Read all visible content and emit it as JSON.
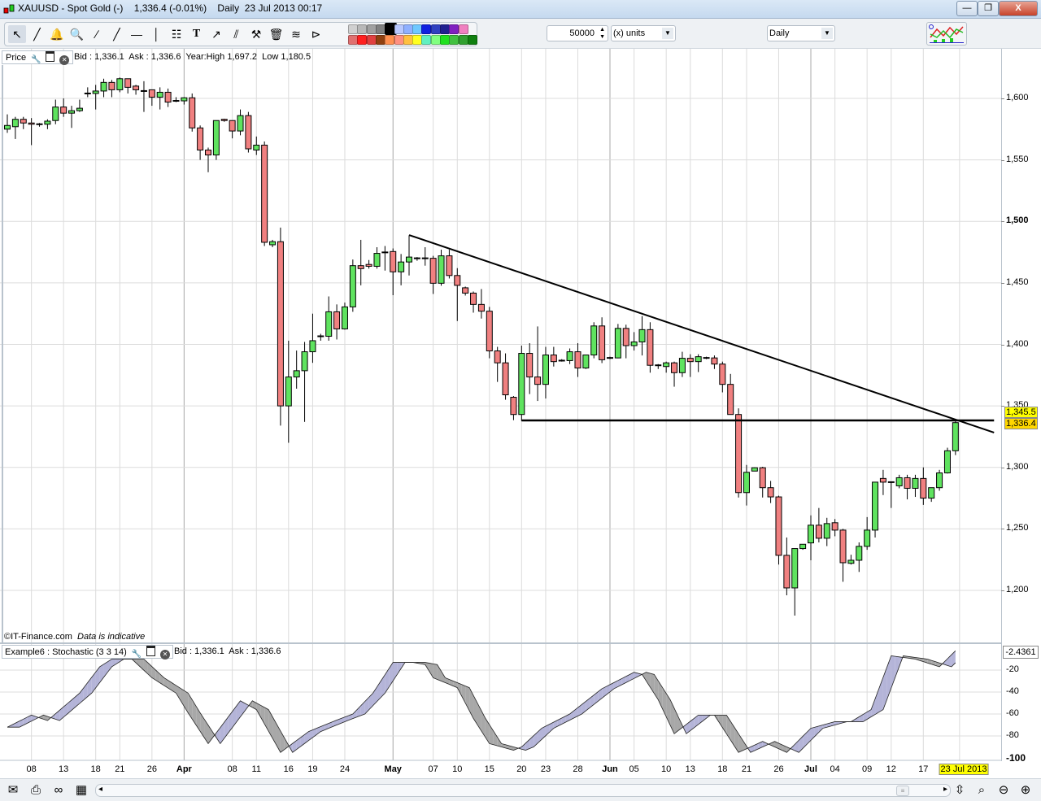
{
  "window": {
    "title": "XAUUSD - Spot Gold (-)    1,336.4 (-0.01%)    Daily  23 Jul 2013 00:17",
    "minimize": "—",
    "restore": "❐",
    "close": "X"
  },
  "toolbar": {
    "tools": [
      {
        "name": "pointer-icon",
        "glyph": "↖"
      },
      {
        "name": "ruler-icon",
        "glyph": "╱"
      },
      {
        "name": "alert-bell-icon",
        "glyph": "🔔"
      },
      {
        "name": "zoom-icon",
        "glyph": "🔍"
      },
      {
        "name": "trend-line-icon",
        "glyph": "∕"
      },
      {
        "name": "extended-line-icon",
        "glyph": "╱"
      },
      {
        "name": "horizontal-line-icon",
        "glyph": "—"
      },
      {
        "name": "vertical-line-icon",
        "glyph": "│"
      },
      {
        "name": "fibonacci-icon",
        "glyph": "☷"
      },
      {
        "name": "text-icon",
        "glyph": "T"
      },
      {
        "name": "channel-icon",
        "glyph": "↗"
      },
      {
        "name": "parallel-lines-icon",
        "glyph": "⫽"
      },
      {
        "name": "tools-icon",
        "glyph": "⚒"
      },
      {
        "name": "delete-icon",
        "glyph": "🗑"
      },
      {
        "name": "support-resistance-icon",
        "glyph": "≋"
      },
      {
        "name": "triangle-pattern-icon",
        "glyph": "⊳"
      }
    ],
    "swatches_top": [
      "#d0d0d0",
      "#b8b8b8",
      "#a0a0a0",
      "#808080",
      "#000000",
      "#b8c8ff",
      "#8fb0ff",
      "#6fc8ff",
      "#1020e0",
      "#3040c0",
      "#202090",
      "#8020c0",
      "#f080c0"
    ],
    "swatches_bottom": [
      "#e07070",
      "#ff2020",
      "#e04040",
      "#904010",
      "#ff9050",
      "#ff9080",
      "#ffc040",
      "#ffff20",
      "#60f0c0",
      "#80ff80",
      "#20e020",
      "#40c040",
      "#30a030",
      "#108010"
    ],
    "quantity": "50000",
    "units": "(x) units",
    "period": "Daily"
  },
  "price_pane": {
    "label": "Price",
    "info": "Bid : 1,336.1  Ask : 1,336.6  Year:High 1,697.2  Low 1,180.5",
    "watermark_site": "©IT-Finance.com",
    "watermark_note": "Data is indicative",
    "axis_labels": [
      {
        "value": 1600,
        "text": "1,600"
      },
      {
        "value": 1550,
        "text": "1,550"
      },
      {
        "value": 1500,
        "text": "1,500",
        "bold": true
      },
      {
        "value": 1450,
        "text": "1,450"
      },
      {
        "value": 1400,
        "text": "1,400"
      },
      {
        "value": 1350,
        "text": "1,350"
      },
      {
        "value": 1300,
        "text": "1,300"
      },
      {
        "value": 1250,
        "text": "1,250"
      },
      {
        "value": 1200,
        "text": "1,200"
      }
    ],
    "tag_line": "1,345.5",
    "tag_last": "1,336.4"
  },
  "stoch_pane": {
    "label": "Example6 : Stochastic (3 3 14)",
    "info": "Bid : 1,336.1  Ask : 1,336.6",
    "current_value": "-2.4361",
    "axis_labels": [
      {
        "value": -20,
        "text": "-20"
      },
      {
        "value": -40,
        "text": "-40"
      },
      {
        "value": -60,
        "text": "-60"
      },
      {
        "value": -80,
        "text": "-80"
      },
      {
        "value": -100,
        "text": "-100",
        "bold": true
      }
    ]
  },
  "date_axis": [
    {
      "i": 3,
      "t": "08"
    },
    {
      "i": 7,
      "t": "13"
    },
    {
      "i": 11,
      "t": "18"
    },
    {
      "i": 14,
      "t": "21"
    },
    {
      "i": 18,
      "t": "26"
    },
    {
      "i": 22,
      "t": "Apr",
      "month": true
    },
    {
      "i": 28,
      "t": "08"
    },
    {
      "i": 31,
      "t": "11"
    },
    {
      "i": 35,
      "t": "16"
    },
    {
      "i": 38,
      "t": "19"
    },
    {
      "i": 42,
      "t": "24"
    },
    {
      "i": 48,
      "t": "May",
      "month": true
    },
    {
      "i": 53,
      "t": "07"
    },
    {
      "i": 56,
      "t": "10"
    },
    {
      "i": 60,
      "t": "15"
    },
    {
      "i": 64,
      "t": "20"
    },
    {
      "i": 67,
      "t": "23"
    },
    {
      "i": 71,
      "t": "28"
    },
    {
      "i": 75,
      "t": "Jun",
      "month": true
    },
    {
      "i": 78,
      "t": "05"
    },
    {
      "i": 82,
      "t": "10"
    },
    {
      "i": 85,
      "t": "13"
    },
    {
      "i": 89,
      "t": "18"
    },
    {
      "i": 92,
      "t": "21"
    },
    {
      "i": 96,
      "t": "26"
    },
    {
      "i": 100,
      "t": "Jul",
      "month": true
    },
    {
      "i": 103,
      "t": "04"
    },
    {
      "i": 107,
      "t": "09"
    },
    {
      "i": 110,
      "t": "12"
    },
    {
      "i": 114,
      "t": "17"
    }
  ],
  "current_date": "23 Jul 2013",
  "bottombar": {
    "icons": [
      {
        "name": "email-icon",
        "glyph": "✉"
      },
      {
        "name": "print-icon",
        "glyph": "⎙"
      },
      {
        "name": "link-icon",
        "glyph": "∞"
      },
      {
        "name": "report-icon",
        "glyph": "▦"
      }
    ],
    "right_icons": [
      {
        "name": "autoscale-icon",
        "glyph": "⇳"
      },
      {
        "name": "zoom-fit-icon",
        "glyph": "⌕"
      },
      {
        "name": "zoom-out-icon",
        "glyph": "⊖"
      },
      {
        "name": "zoom-in-icon",
        "glyph": "⊕"
      }
    ],
    "scroll_left": "◂",
    "scroll_right": "▸",
    "thumb": "≡"
  },
  "colors": {
    "up": "#5fe35f",
    "down": "#f08080",
    "grid": "#dcdcdc",
    "month_grid": "#a8a8a8",
    "stoch_k_fill": "#b4b4d8",
    "stoch_d_fill": "#a8a8a8"
  },
  "chart_data": {
    "type": "candlestick",
    "symbol": "XAUUSD",
    "period": "Daily",
    "ylim": [
      1160,
      1650
    ],
    "candles_ohlc": [
      [
        1575,
        1587,
        1572,
        1578
      ],
      [
        1577,
        1585,
        1567,
        1583
      ],
      [
        1583,
        1585,
        1575,
        1580
      ],
      [
        1580,
        1584,
        1562,
        1579
      ],
      [
        1579,
        1580,
        1577,
        1579
      ],
      [
        1579,
        1583,
        1575,
        1581.5
      ],
      [
        1582,
        1599,
        1579,
        1593
      ],
      [
        1593,
        1600,
        1585,
        1588
      ],
      [
        1588,
        1594,
        1576,
        1590
      ],
      [
        1590,
        1599,
        1589,
        1592
      ],
      [
        1604,
        1609,
        1601,
        1604
      ],
      [
        1604,
        1611,
        1591,
        1606
      ],
      [
        1606,
        1616,
        1601,
        1613
      ],
      [
        1613,
        1615,
        1601,
        1607
      ],
      [
        1607,
        1617,
        1605,
        1616
      ],
      [
        1616,
        1616,
        1604,
        1609
      ],
      [
        1610,
        1611,
        1603,
        1607
      ],
      [
        1606,
        1614,
        1589,
        1606
      ],
      [
        1607,
        1607,
        1594,
        1601
      ],
      [
        1601,
        1609,
        1591,
        1605
      ],
      [
        1605,
        1608,
        1593,
        1597
      ],
      [
        1598,
        1601,
        1597,
        1598
      ],
      [
        1598,
        1601,
        1595,
        1600.5
      ],
      [
        1600.5,
        1604,
        1573,
        1576
      ],
      [
        1576,
        1578,
        1550,
        1558
      ],
      [
        1558,
        1560,
        1540,
        1554
      ],
      [
        1554,
        1582,
        1550,
        1582
      ],
      [
        1583,
        1583.5,
        1581,
        1582
      ],
      [
        1582,
        1582,
        1567.5,
        1573.5
      ],
      [
        1573.5,
        1591,
        1570,
        1586
      ],
      [
        1586,
        1589,
        1556,
        1559
      ],
      [
        1558,
        1569,
        1554,
        1562
      ],
      [
        1562,
        1565,
        1480,
        1483
      ],
      [
        1481,
        1485,
        1479,
        1483.5
      ],
      [
        1483.5,
        1495,
        1334,
        1350
      ],
      [
        1350,
        1403,
        1320,
        1373.5
      ],
      [
        1373.5,
        1395,
        1364,
        1378.6
      ],
      [
        1378.6,
        1402,
        1337,
        1394
      ],
      [
        1394,
        1425,
        1385,
        1403
      ],
      [
        1406.6,
        1408.6,
        1403,
        1406.6
      ],
      [
        1406.6,
        1439,
        1403,
        1426.5
      ],
      [
        1426.5,
        1432.5,
        1404,
        1412.6
      ],
      [
        1412.6,
        1434,
        1412,
        1430.5
      ],
      [
        1430.5,
        1469,
        1426.5,
        1464
      ],
      [
        1464,
        1485,
        1448,
        1461.6
      ],
      [
        1465,
        1468.6,
        1461.6,
        1463.5
      ],
      [
        1463.5,
        1479,
        1461.6,
        1474
      ],
      [
        1474.8,
        1480,
        1460,
        1474.8
      ],
      [
        1475.5,
        1478,
        1440,
        1459
      ],
      [
        1459,
        1473.5,
        1448,
        1467
      ],
      [
        1467,
        1488.7,
        1456,
        1471
      ],
      [
        1470,
        1471,
        1468,
        1470
      ],
      [
        1470,
        1479,
        1464,
        1470
      ],
      [
        1470,
        1472,
        1441,
        1449.7
      ],
      [
        1449.7,
        1477,
        1447.7,
        1472
      ],
      [
        1472,
        1477,
        1453.6,
        1456
      ],
      [
        1456,
        1462,
        1419,
        1448
      ],
      [
        1446,
        1447,
        1439.7,
        1441.7
      ],
      [
        1441.7,
        1443,
        1425.8,
        1432.5
      ],
      [
        1432.5,
        1445,
        1421,
        1427
      ],
      [
        1427,
        1430.5,
        1388.7,
        1394.7
      ],
      [
        1394.7,
        1398,
        1369.5,
        1385
      ],
      [
        1385,
        1392.7,
        1355,
        1359
      ],
      [
        1357,
        1358,
        1338.4,
        1343
      ],
      [
        1343,
        1399,
        1337.7,
        1392.7
      ],
      [
        1392.7,
        1401,
        1359.6,
        1373.5
      ],
      [
        1373.5,
        1414.6,
        1354,
        1367.5
      ],
      [
        1367.5,
        1398,
        1356,
        1391.4
      ],
      [
        1391.4,
        1398,
        1382,
        1386
      ],
      [
        1386.8,
        1388,
        1386,
        1386.8
      ],
      [
        1386.8,
        1396.7,
        1384,
        1394
      ],
      [
        1394,
        1401,
        1373.5,
        1380.8
      ],
      [
        1380.8,
        1391.4,
        1380,
        1391.4
      ],
      [
        1391.4,
        1418,
        1388.7,
        1415
      ],
      [
        1415,
        1422,
        1384.8,
        1387.5
      ],
      [
        1389,
        1390,
        1388,
        1389
      ],
      [
        1389,
        1416.6,
        1388.7,
        1413
      ],
      [
        1413,
        1416,
        1388.7,
        1399
      ],
      [
        1399,
        1410,
        1395,
        1402
      ],
      [
        1402,
        1423,
        1391,
        1412
      ],
      [
        1412,
        1418,
        1377,
        1383
      ],
      [
        1383,
        1384,
        1380,
        1383
      ],
      [
        1382,
        1386,
        1377,
        1385
      ],
      [
        1385,
        1386,
        1365.6,
        1377
      ],
      [
        1377,
        1394,
        1373.5,
        1388.7
      ],
      [
        1388.7,
        1392,
        1373.5,
        1386
      ],
      [
        1386,
        1392,
        1377.5,
        1390
      ],
      [
        1389,
        1390,
        1388,
        1389
      ],
      [
        1389,
        1391,
        1380,
        1384
      ],
      [
        1384,
        1386,
        1361,
        1367.5
      ],
      [
        1367.5,
        1376,
        1343,
        1343
      ],
      [
        1343,
        1348,
        1275.5,
        1279.5
      ],
      [
        1279.5,
        1302,
        1269,
        1296
      ],
      [
        1297,
        1300,
        1297,
        1299.7
      ],
      [
        1299.7,
        1300.5,
        1275.5,
        1283.5
      ],
      [
        1283.5,
        1289,
        1271,
        1276
      ],
      [
        1276,
        1277,
        1221,
        1228.5
      ],
      [
        1228.5,
        1243,
        1196,
        1202
      ],
      [
        1202,
        1234,
        1179.5,
        1234
      ],
      [
        1234,
        1237.5,
        1233,
        1237.5
      ],
      [
        1238.6,
        1261,
        1224.5,
        1253
      ],
      [
        1253,
        1267,
        1239,
        1242.4
      ],
      [
        1242.4,
        1259,
        1236,
        1254.3
      ],
      [
        1255,
        1258,
        1244,
        1249
      ],
      [
        1249,
        1250,
        1207,
        1222.5
      ],
      [
        1222,
        1229,
        1221,
        1224.5
      ],
      [
        1224.5,
        1239,
        1215,
        1235.8
      ],
      [
        1235.8,
        1259.6,
        1233,
        1249
      ],
      [
        1249,
        1288,
        1243,
        1288
      ],
      [
        1291,
        1298,
        1277.5,
        1288
      ],
      [
        1288,
        1288,
        1267,
        1288
      ],
      [
        1285,
        1294,
        1283,
        1291.6
      ],
      [
        1291.6,
        1294,
        1274,
        1283
      ],
      [
        1283,
        1294,
        1276,
        1291
      ],
      [
        1291,
        1300,
        1269.5,
        1275
      ],
      [
        1275,
        1283.5,
        1272,
        1283.5
      ],
      [
        1283.5,
        1298,
        1281,
        1295.5
      ],
      [
        1295.5,
        1316,
        1295,
        1313.5
      ],
      [
        1313.5,
        1338.4,
        1310,
        1336.4
      ]
    ],
    "trend_line": {
      "from": [
        50,
        1488.9
      ],
      "to": [
        122.8,
        1328.3
      ]
    },
    "horizontal_line": {
      "from": [
        64,
        1338.2
      ],
      "to": [
        122.8,
        1338.2
      ]
    },
    "stochastic": {
      "ylim": [
        -100,
        0
      ],
      "k_points": [
        [
          0,
          -72
        ],
        [
          3,
          -61
        ],
        [
          5,
          -66
        ],
        [
          9,
          -41
        ],
        [
          11.5,
          -17
        ],
        [
          13,
          -10
        ],
        [
          15.5,
          -10
        ],
        [
          18,
          -27
        ],
        [
          21,
          -41
        ],
        [
          22.5,
          -59
        ],
        [
          25,
          -87
        ],
        [
          29,
          -48
        ],
        [
          31,
          -56
        ],
        [
          34,
          -95
        ],
        [
          37.5,
          -76
        ],
        [
          40.5,
          -67
        ],
        [
          43,
          -60
        ],
        [
          45.5,
          -41
        ],
        [
          48,
          -13
        ],
        [
          50.5,
          -13
        ],
        [
          52,
          -15
        ],
        [
          53,
          -27
        ],
        [
          56,
          -36
        ],
        [
          58,
          -64
        ],
        [
          60,
          -87
        ],
        [
          63,
          -93
        ],
        [
          64,
          -90
        ],
        [
          66.5,
          -73
        ],
        [
          70,
          -60
        ],
        [
          74,
          -37
        ],
        [
          78,
          -22
        ],
        [
          79,
          -24
        ],
        [
          81,
          -47
        ],
        [
          83,
          -78
        ],
        [
          86,
          -61
        ],
        [
          88,
          -61
        ],
        [
          91,
          -95
        ],
        [
          94,
          -85
        ],
        [
          97,
          -95
        ],
        [
          100,
          -73
        ],
        [
          103,
          -67
        ],
        [
          105,
          -67
        ],
        [
          107.5,
          -56
        ],
        [
          110,
          -7
        ],
        [
          113,
          -10
        ],
        [
          116,
          -17
        ],
        [
          118,
          -2.4361
        ]
      ]
    }
  }
}
